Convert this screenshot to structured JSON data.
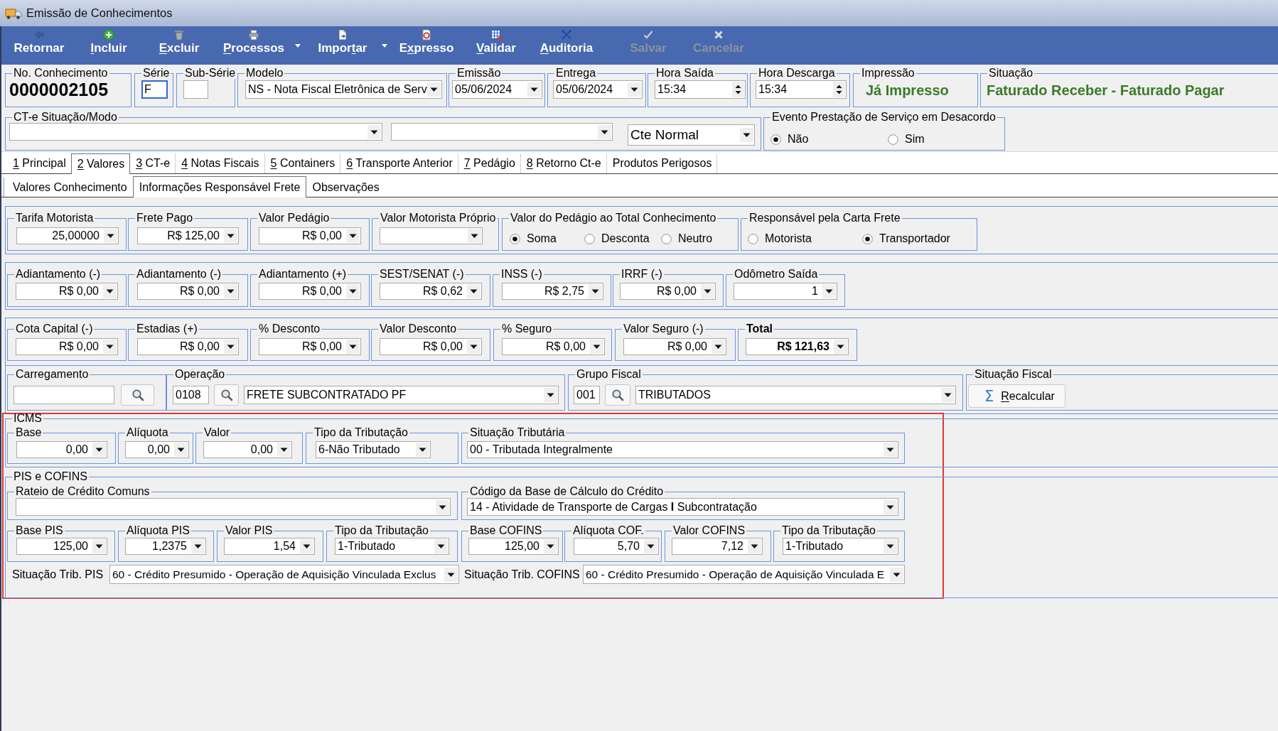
{
  "window": {
    "title": "Emissão de Conhecimentos"
  },
  "toolbar": [
    {
      "label": [
        {
          "text": "Retornar",
          "underlined": false
        }
      ],
      "dropdown": false,
      "disabled": false
    },
    {
      "label": [
        {
          "text": "I",
          "underlined": true
        },
        {
          "text": "ncluir",
          "underlined": false
        }
      ],
      "dropdown": false,
      "disabled": false
    },
    {
      "label": [
        {
          "text": "E",
          "underlined": true
        },
        {
          "text": "xcluir",
          "underlined": false
        }
      ],
      "dropdown": false,
      "disabled": false
    },
    {
      "label": [
        {
          "text": "P",
          "underlined": true
        },
        {
          "text": "rocessos",
          "underlined": false
        }
      ],
      "dropdown": true,
      "disabled": false
    },
    {
      "label": [
        {
          "text": "Impor",
          "underlined": false
        },
        {
          "text": "t",
          "underlined": true
        },
        {
          "text": "ar",
          "underlined": false
        }
      ],
      "dropdown": true,
      "disabled": false
    },
    {
      "label": [
        {
          "text": "E",
          "underlined": false
        },
        {
          "text": "x",
          "underlined": true
        },
        {
          "text": "presso",
          "underlined": false
        }
      ],
      "dropdown": false,
      "disabled": false
    },
    {
      "label": [
        {
          "text": "V",
          "underlined": true
        },
        {
          "text": "alidar",
          "underlined": false
        }
      ],
      "dropdown": false,
      "disabled": false
    },
    {
      "label": [
        {
          "text": "A",
          "underlined": true
        },
        {
          "text": "uditoria",
          "underlined": false
        }
      ],
      "dropdown": false,
      "disabled": false
    },
    {
      "label": [
        {
          "text": "Salvar",
          "underlined": false
        }
      ],
      "dropdown": false,
      "disabled": true
    },
    {
      "label": [
        {
          "text": "Cancelar",
          "underlined": false
        }
      ],
      "dropdown": false,
      "disabled": true
    }
  ],
  "header": [
    {
      "kind": "number",
      "label": "No. Conhecimento",
      "value": "0000002105"
    },
    {
      "kind": "text",
      "label": "Série",
      "value": "F",
      "focused": true
    },
    {
      "kind": "text",
      "label": "Sub-Série",
      "focused": false
    },
    {
      "kind": "choice",
      "label": "Modelo",
      "value": "NS - Nota Fiscal Eletrônica de Serv"
    },
    {
      "kind": "choice",
      "label": "Emissão",
      "value": "05/06/2024"
    },
    {
      "kind": "choice",
      "label": "Entrega",
      "value": "05/06/2024"
    },
    {
      "kind": "spin",
      "label": "Hora Saída",
      "value": "15:34"
    },
    {
      "kind": "spin",
      "label": "Hora Descarga",
      "value": "15:34"
    },
    {
      "kind": "status",
      "label": "Impressão",
      "value": "Já Impresso"
    },
    {
      "kind": "status",
      "label": "Situação",
      "value": "Faturado Receber - Faturado Pagar"
    }
  ],
  "ct_e_mode": {
    "label": "CT-e Situação/Modo",
    "selects": [
      {
        "kind": "choice"
      },
      {
        "kind": "choice"
      },
      {
        "kind": "choice",
        "value": "Cte Normal"
      }
    ]
  },
  "evento": {
    "label": "Evento Prestação de Serviço em Desacordo",
    "options": [
      {
        "label": "Não",
        "selected": true
      },
      {
        "label": "Sim",
        "selected": false
      }
    ]
  },
  "tabs": [
    {
      "key": "1",
      "label": "Principal",
      "selected": false
    },
    {
      "key": "2",
      "label": "Valores",
      "selected": true
    },
    {
      "key": "3",
      "label": "CT-e",
      "selected": false
    },
    {
      "key": "4",
      "label": "Notas Fiscais",
      "selected": false
    },
    {
      "key": "5",
      "label": "Containers",
      "selected": false
    },
    {
      "key": "6",
      "label": "Transporte Anterior",
      "selected": false
    },
    {
      "key": "7",
      "label": "Pedágio",
      "selected": false
    },
    {
      "key": "8",
      "label": "Retorno Ct-e",
      "selected": false
    },
    {
      "label": "Produtos Perigosos",
      "selected": false
    }
  ],
  "subtabs": [
    {
      "label": "Valores Conhecimento",
      "selected": false
    },
    {
      "label": "Informações Responsável Frete",
      "selected": true
    },
    {
      "label": "Observações",
      "selected": false
    }
  ],
  "value_rows": [
    {
      "fields": [
        {
          "kind": "amount",
          "label": "Tarifa Motorista",
          "value": "25,00000"
        },
        {
          "kind": "amount",
          "label": "Frete Pago",
          "value": "R$ 125,00"
        },
        {
          "kind": "amount",
          "label": "Valor Pedágio",
          "value": "R$ 0,00"
        },
        {
          "kind": "amount",
          "label": "Valor Motorista Próprio"
        },
        {
          "kind": "radio",
          "label": "Valor do Pedágio ao Total Conhecimento",
          "options": [
            {
              "label": "Soma",
              "selected": true
            },
            {
              "label": "Desconta",
              "selected": false
            },
            {
              "label": "Neutro",
              "selected": false
            }
          ]
        },
        {
          "kind": "radio",
          "label": "Responsável pela Carta Frete",
          "options": [
            {
              "label": "Motorista",
              "selected": false
            },
            {
              "label": "Transportador",
              "selected": true
            }
          ]
        }
      ]
    },
    {
      "fields": [
        {
          "kind": "amount",
          "label": "Adiantamento (-)",
          "value": "R$ 0,00"
        },
        {
          "kind": "amount",
          "label": "Adiantamento (-)",
          "value": "R$ 0,00"
        },
        {
          "kind": "amount",
          "label": "Adiantamento (+)",
          "value": "R$ 0,00"
        },
        {
          "kind": "amount",
          "label": "SEST/SENAT (-)",
          "value": "R$ 0,62"
        },
        {
          "kind": "amount",
          "label": "INSS (-)",
          "value": "R$ 2,75"
        },
        {
          "kind": "amount",
          "label": "IRRF (-)",
          "value": "R$ 0,00"
        },
        {
          "kind": "amount",
          "label": "Odômetro Saída",
          "value": "1"
        }
      ]
    },
    {
      "fields": [
        {
          "kind": "amount",
          "label": "Cota Capital (-)",
          "value": "R$ 0,00"
        },
        {
          "kind": "amount",
          "label": "Estadias (+)",
          "value": "R$ 0,00"
        },
        {
          "kind": "amount",
          "label": "% Desconto",
          "value": "R$ 0,00"
        },
        {
          "kind": "amount",
          "label": "Valor Desconto",
          "value": "R$ 0,00"
        },
        {
          "kind": "amount",
          "label": "% Seguro",
          "value": "R$ 0,00"
        },
        {
          "kind": "amount",
          "label": "Valor Seguro (-)",
          "value": "R$ 0,00"
        },
        {
          "kind": "total",
          "label": "Total",
          "value": "R$ 121,63"
        }
      ]
    }
  ],
  "lookup_row": [
    {
      "kind": "lookup",
      "label": "Carregamento"
    },
    {
      "kind": "code_lookup",
      "label": "Operação",
      "code": "0108",
      "value": "FRETE SUBCONTRATADO PF"
    },
    {
      "kind": "code_lookup",
      "label": "Grupo Fiscal",
      "code": "001",
      "value": "TRIBUTADOS"
    },
    {
      "kind": "action",
      "label": "Situação Fiscal",
      "icon": "Σ",
      "button": [
        {
          "text": "R",
          "underlined": true
        },
        {
          "text": "ecalcular",
          "underlined": false
        }
      ]
    }
  ],
  "taxes": {
    "highlighted": true,
    "groups": [
      {
        "label": "ICMS",
        "rows": [
          {
            "fields": [
              {
                "kind": "amount",
                "label": "Base",
                "value": "0,00"
              },
              {
                "kind": "amount",
                "label": "Alíquota",
                "value": "0,00"
              },
              {
                "kind": "amount",
                "label": "Valor",
                "value": "0,00"
              },
              {
                "kind": "choice",
                "label": "Tipo da Tributação",
                "value": "6-Não Tributado"
              },
              {
                "kind": "choice",
                "label": "Situação Tributária",
                "value": "00 - Tributada Integralmente"
              }
            ]
          }
        ]
      },
      {
        "label": "PIS e COFINS",
        "rows": [
          {
            "fields": [
              {
                "kind": "choice",
                "label": "Rateio de Crédito Comuns"
              },
              {
                "kind": "choice",
                "label": "Código da Base de Cálculo do Crédito",
                "value": "14 - Atividade de Transporte de Cargas **I** Subcontratação"
              }
            ]
          },
          {
            "fields": [
              {
                "kind": "amount",
                "label": "Base PIS",
                "value": "125,00"
              },
              {
                "kind": "amount",
                "label": "Alíquota PIS",
                "value": "1,2375"
              },
              {
                "kind": "amount",
                "label": "Valor PIS",
                "value": "1,54"
              },
              {
                "kind": "choice",
                "label": "Tipo da Tributação",
                "value": "1-Tributado"
              },
              {
                "kind": "amount",
                "label": "Base COFINS",
                "value": "125,00"
              },
              {
                "kind": "amount",
                "label": "Alíquota COF.",
                "value": "5,70"
              },
              {
                "kind": "amount",
                "label": "Valor COFINS",
                "value": "7,12"
              },
              {
                "kind": "choice",
                "label": "Tipo da Tributação",
                "value": "1-Tributado"
              }
            ]
          },
          {
            "fields": [
              {
                "kind": "inline_choice",
                "label": "Situação Trib. PIS",
                "value": "60 - Crédito Presumido - Operação de Aquisição Vinculada Exclus"
              },
              {
                "kind": "inline_choice",
                "label": "Situação Trib. COFINS",
                "value": "60 - Crédito Presumido - Operação de Aquisição Vinculada E"
              }
            ]
          }
        ]
      }
    ]
  }
}
